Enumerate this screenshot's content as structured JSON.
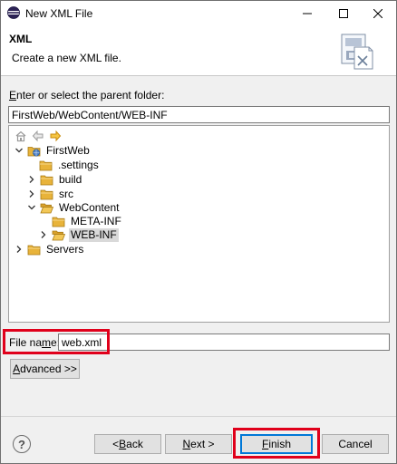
{
  "window": {
    "title": "New XML File",
    "minimize": "—",
    "maximize": "☐",
    "close": "✕"
  },
  "banner": {
    "title": "XML",
    "description": "Create a new XML file."
  },
  "parent_folder": {
    "label_prefix": "",
    "label_mnemonic": "E",
    "label_rest": "nter or select the parent folder:",
    "value": "FirstWeb/WebContent/WEB-INF"
  },
  "tree": {
    "toolbar_icons": [
      "home-icon",
      "back-icon",
      "forward-icon"
    ],
    "nodes": [
      {
        "label": "FirstWeb",
        "icon": "project-icon",
        "expanded": true,
        "selected": false
      },
      {
        "label": ".settings",
        "icon": "folder-icon",
        "expanded": false,
        "selected": false
      },
      {
        "label": "build",
        "icon": "folder-icon",
        "expanded": false,
        "selected": false
      },
      {
        "label": "src",
        "icon": "folder-icon",
        "expanded": false,
        "selected": false
      },
      {
        "label": "WebContent",
        "icon": "folder-open-icon",
        "expanded": true,
        "selected": false
      },
      {
        "label": "META-INF",
        "icon": "folder-icon",
        "expanded": false,
        "selected": false
      },
      {
        "label": "WEB-INF",
        "icon": "folder-open-icon",
        "expanded": false,
        "selected": true
      },
      {
        "label": "Servers",
        "icon": "folder-icon",
        "expanded": false,
        "selected": false
      }
    ]
  },
  "file_name": {
    "label_prefix": "File na",
    "label_mnemonic": "m",
    "label_rest": "e:",
    "value": "web.xml"
  },
  "buttons": {
    "advanced_mnemonic": "A",
    "advanced_rest": "dvanced >>",
    "back_prefix": "< ",
    "back_mnemonic": "B",
    "back_rest": "ack",
    "next_mnemonic": "N",
    "next_rest": "ext >",
    "finish_mnemonic": "F",
    "finish_rest": "inish",
    "cancel": "Cancel",
    "help": "?"
  },
  "colors": {
    "highlight": "#e0001b",
    "folder": "#e8b33a",
    "selection": "#d9d9d9",
    "default_button": "#0078d7"
  }
}
